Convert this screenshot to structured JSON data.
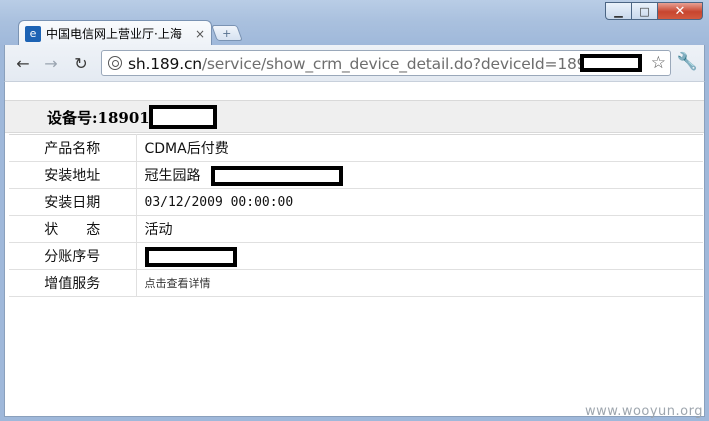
{
  "window": {
    "minimize_glyph": "▁",
    "maximize_glyph": "□",
    "close_glyph": "✕"
  },
  "tab": {
    "favicon": "e",
    "title": "中国电信网上营业厅·上海",
    "close_glyph": "×",
    "new_tab_glyph": "+"
  },
  "toolbar": {
    "back_glyph": "←",
    "forward_glyph": "→",
    "reload_glyph": "↻",
    "url_host": "sh.189.cn",
    "url_path": "/service/show_crm_device_detail.do?deviceId=18901",
    "star_glyph": "☆",
    "wrench_glyph": "🔧"
  },
  "device": {
    "title": "设备号:18901"
  },
  "details": [
    {
      "label": "产品名称",
      "value": "CDMA后付费"
    },
    {
      "label": "安装地址",
      "value": "冠生园路"
    },
    {
      "label": "安装日期",
      "value": "03/12/2009 00:00:00"
    },
    {
      "label": "状　　态",
      "value": "活动"
    },
    {
      "label": "分账序号",
      "value": ""
    },
    {
      "label": "增值服务",
      "value": "点击查看详情"
    }
  ],
  "watermark": "www.wooyun.org",
  "colors": {
    "frame": "#a9c0de",
    "close_button": "#c7452f",
    "device_bar": "#efefef"
  }
}
